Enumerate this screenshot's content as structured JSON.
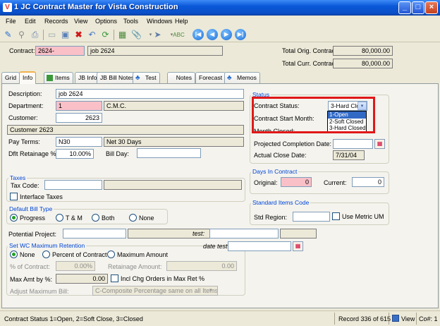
{
  "window": {
    "title": "1 JC Contract Master for Vista Construction",
    "app_icon": "V"
  },
  "menu": [
    "File",
    "Edit",
    "Records",
    "View",
    "Options",
    "Tools",
    "Windows",
    "Help"
  ],
  "header": {
    "contract_label": "Contract:",
    "contract_value": "2624-",
    "contract_desc": "job 2624",
    "total_orig_label": "Total Orig. Contract:",
    "total_orig_value": "80,000.00",
    "total_curr_label": "Total Curr. Contract:",
    "total_curr_value": "80,000.00"
  },
  "tabs": [
    "Grid",
    "Info",
    "Items",
    "JB Info",
    "JB Bill Notes",
    "Test",
    "Notes",
    "Forecast",
    "Memos"
  ],
  "info": {
    "description_label": "Description:",
    "description_value": "job 2624",
    "department_label": "Department:",
    "department_value": "1",
    "department_desc": "C.M.C.",
    "customer_label": "Customer:",
    "customer_value": "2623",
    "customer_name": "Customer 2623",
    "pay_terms_label": "Pay Terms:",
    "pay_terms_value": "N30",
    "pay_terms_desc": "Net 30 Days",
    "dflt_retainage_label": "Dflt Retainage %:",
    "dflt_retainage_value": "10.00%",
    "bill_day_label": "Bill Day:",
    "bill_day_value": ""
  },
  "status": {
    "group_title": "Status",
    "contract_status_label": "Contract Status:",
    "contract_status_value": "3-Hard Closed",
    "options": [
      "1-Open",
      "2-Soft Closed",
      "3-Hard Closed"
    ],
    "start_month_label": "Contract Start Month:",
    "month_closed_label": "Month Closed:",
    "projected_completion_label": "Projected Completion Date:",
    "projected_completion_value": "",
    "actual_close_label": "Actual Close Date:",
    "actual_close_value": "7/31/04"
  },
  "days": {
    "group_title": "Days In Contract",
    "original_label": "Original:",
    "original_value": "0",
    "current_label": "Current:",
    "current_value": "0"
  },
  "taxes": {
    "group_title": "Taxes",
    "tax_code_label": "Tax Code:",
    "interface_label": "Interface Taxes"
  },
  "bill_type": {
    "group_title": "Default Bill Type",
    "options": [
      "Progress",
      "T & M",
      "Both",
      "None"
    ],
    "selected": "Progress"
  },
  "standard_items": {
    "group_title": "Standard Items Code",
    "std_region_label": "Std Region:",
    "metric_label": "Use Metric UM"
  },
  "potential_project_label": "Potential Project:",
  "test_label": "test:",
  "date_test_label": "date test:",
  "wc_max": {
    "group_title": "Set WC Maximum Retention",
    "options": [
      "None",
      "Percent of Contract",
      "Maximum Amount"
    ],
    "selected": "None",
    "pct_contract_label": "% of Contract:",
    "pct_contract_value": "0.00%",
    "retainage_amount_label": "Retainage Amount:",
    "retainage_amount_value": "0.00",
    "max_amt_label": "Max Amt by %:",
    "max_amt_value": "0.00",
    "incl_chg_label": "Incl Chg Orders in Max Ret %",
    "adjust_label": "Adjust Maximum Bill:",
    "adjust_value": "C-Composite Percentage same on all Items"
  },
  "statusbar": {
    "message": "Contract Status 1=Open, 2=Soft Close, 3=Closed",
    "record": "Record 336 of 615",
    "view": "View",
    "company": "Co#: 1"
  }
}
